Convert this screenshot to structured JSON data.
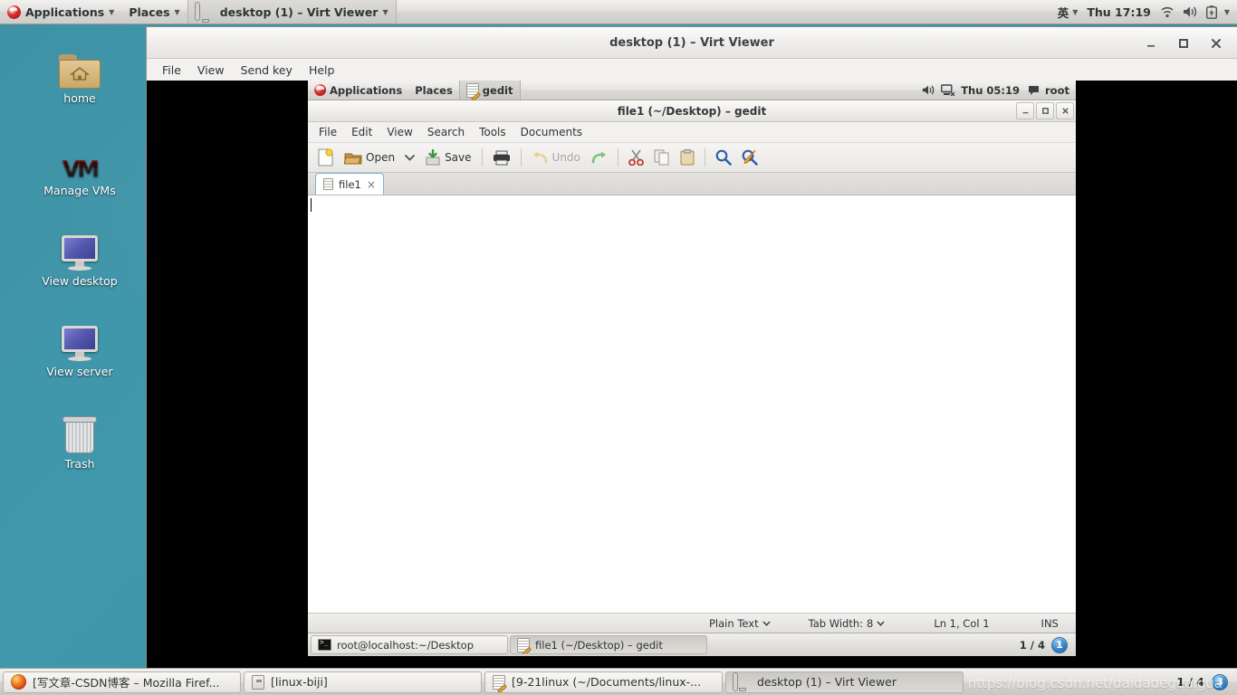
{
  "host": {
    "top_panel": {
      "applications_label": "Applications",
      "places_label": "Places",
      "active_window_label": "desktop (1) – Virt Viewer",
      "ime_label": "英",
      "clock": "Thu 17:19",
      "icons": [
        "fedora-logo",
        "monitor-icon",
        "caret-down-icon",
        "wifi-icon",
        "volume-icon",
        "battery-icon"
      ]
    },
    "desktop_icons": [
      {
        "label": "home",
        "icon": "folder-home-icon"
      },
      {
        "label": "Manage VMs",
        "icon": "vmm-logo-icon"
      },
      {
        "label": "View desktop",
        "icon": "monitor-icon"
      },
      {
        "label": "View server",
        "icon": "monitor-icon"
      },
      {
        "label": "Trash",
        "icon": "trash-icon"
      }
    ],
    "taskbar": {
      "buttons": [
        {
          "label": "[写文章-CSDN博客 – Mozilla Firef...",
          "icon": "firefox-icon",
          "state": "up"
        },
        {
          "label": "[linux-biji]",
          "icon": "archive-icon",
          "state": "up"
        },
        {
          "label": "[9-21linux (~/Documents/linux-...",
          "icon": "gedit-icon",
          "state": "up"
        },
        {
          "label": "desktop (1) – Virt Viewer",
          "icon": "monitor-icon",
          "state": "down"
        }
      ],
      "workspace_text": "1 / 4",
      "workspace_badge": "3"
    },
    "watermark": "https://blog.csdn.net/daidadeguaigua"
  },
  "virt_viewer": {
    "title": "desktop (1) – Virt Viewer",
    "menus": [
      "File",
      "View",
      "Send key",
      "Help"
    ],
    "window_buttons": [
      "minimize",
      "maximize",
      "close"
    ]
  },
  "guest": {
    "top_panel": {
      "applications_label": "Applications",
      "places_label": "Places",
      "active_window_label": "gedit",
      "clock": "Thu 05:19",
      "user": "root",
      "icons": [
        "fedora-logo",
        "gedit-icon",
        "volume-icon",
        "network-disconnected-icon",
        "chat-icon"
      ]
    },
    "gedit": {
      "title": "file1 (~/Desktop) – gedit",
      "menus": [
        "File",
        "Edit",
        "View",
        "Search",
        "Tools",
        "Documents"
      ],
      "window_buttons": [
        "minimize",
        "maximize",
        "close"
      ],
      "toolbar": [
        {
          "name": "new-document-button",
          "label": "",
          "icon": "new-document-icon",
          "enabled": true
        },
        {
          "name": "open-button",
          "label": "Open",
          "icon": "open-folder-icon",
          "enabled": true
        },
        {
          "name": "open-dropdown-button",
          "label": "",
          "icon": "chevron-down-icon",
          "enabled": true
        },
        {
          "name": "save-button",
          "label": "Save",
          "icon": "save-icon",
          "enabled": true
        },
        {
          "name": "print-button",
          "label": "",
          "icon": "printer-icon",
          "enabled": true
        },
        {
          "name": "undo-button",
          "label": "Undo",
          "icon": "undo-arrow-icon",
          "enabled": false
        },
        {
          "name": "redo-button",
          "label": "",
          "icon": "redo-arrow-icon",
          "enabled": true
        },
        {
          "name": "cut-button",
          "label": "",
          "icon": "scissors-icon",
          "enabled": true
        },
        {
          "name": "copy-button",
          "label": "",
          "icon": "copy-icon",
          "enabled": true
        },
        {
          "name": "paste-button",
          "label": "",
          "icon": "clipboard-icon",
          "enabled": true
        },
        {
          "name": "find-button",
          "label": "",
          "icon": "magnifier-icon",
          "enabled": true
        },
        {
          "name": "replace-button",
          "label": "",
          "icon": "find-replace-icon",
          "enabled": true
        }
      ],
      "tabs": [
        {
          "label": "file1",
          "close": "×"
        }
      ],
      "document_text": "",
      "status": {
        "language": "Plain Text",
        "tab_width_label": "Tab Width:",
        "tab_width_value": "8",
        "cursor_position": "Ln 1, Col 1",
        "insert_mode": "INS"
      }
    },
    "taskbar": {
      "buttons": [
        {
          "label": "root@localhost:~/Desktop",
          "icon": "terminal-icon",
          "state": "up"
        },
        {
          "label": "file1 (~/Desktop) – gedit",
          "icon": "gedit-icon",
          "state": "down"
        }
      ],
      "workspace_text": "1 / 4",
      "workspace_badge": "1"
    }
  }
}
